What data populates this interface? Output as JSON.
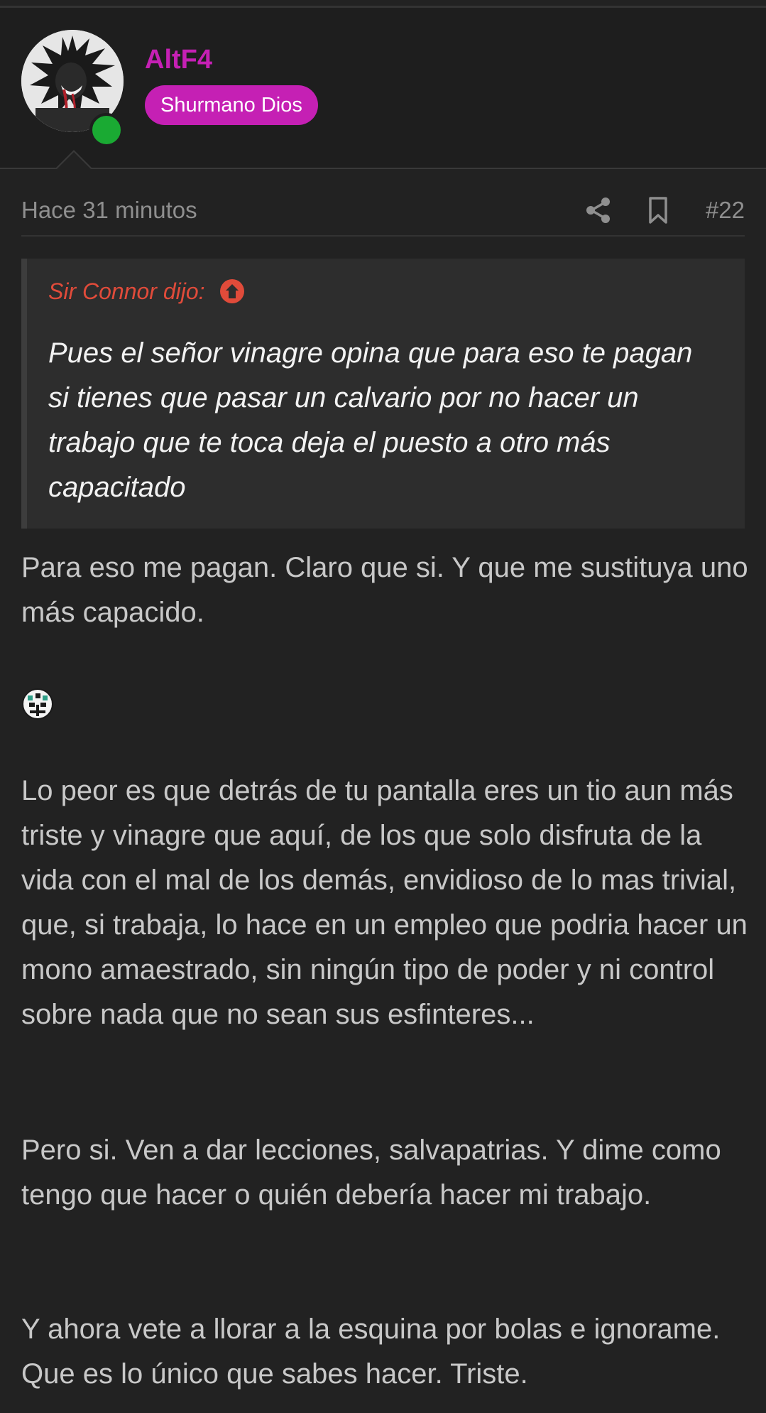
{
  "user": {
    "name": "AltF4",
    "rank": "Shurmano Dios",
    "online": true
  },
  "post": {
    "time": "Hace 31 minutos",
    "number": "#22",
    "share_icon": "share-icon",
    "bookmark_icon": "bookmark-icon"
  },
  "quote": {
    "author": "Sir Connor dijo:",
    "text": "Pues el señor vinagre opina que para eso te pagan si tienes que pasar un calvario por no hacer un trabajo que te toca deja el puesto a otro más capacitado"
  },
  "body": {
    "p1": "Para eso me pagan. Claro que si. Y que me sustituya uno más capacido.",
    "emoji": "smiley-emoji-icon",
    "p2": "Lo peor es que detrás de tu pantalla eres un tio aun más triste y vinagre que aquí, de los que solo disfruta de la vida con el mal de los demás, envidioso de lo mas trivial, que, si trabaja, lo hace en un empleo que podria hacer un mono amaestrado, sin ningún tipo de poder y ni control sobre nada que no sean sus esfinteres...",
    "p3": "Pero si. Ven a dar lecciones, salvapatrias. Y dime como tengo que hacer o quién debería hacer mi trabajo.",
    "p4": "Y ahora vete a llorar a la esquina por bolas e ignorame. Que es lo único que sabes hacer. Triste."
  },
  "colors": {
    "background": "#222222",
    "username": "#c520b4",
    "badge": "#c520b4",
    "online": "#1aaa33",
    "quote_author": "#e04b3a",
    "text": "#c8c8c8"
  }
}
